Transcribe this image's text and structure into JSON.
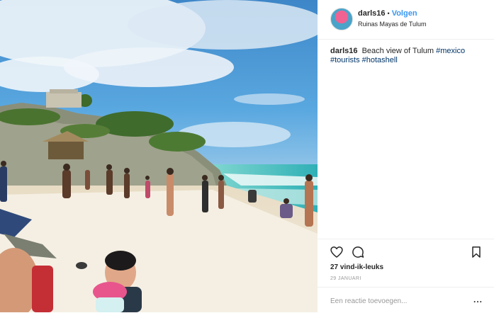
{
  "post": {
    "username": "darls16",
    "separator": "•",
    "follow_label": "Volgen",
    "location": "Ruinas Mayas de Tulum",
    "caption_text": "Beach view of Tulum",
    "hashtags": [
      "#mexico",
      "#tourists",
      "#hotashell"
    ],
    "likes": "27 vind-ik-leuks",
    "date": "29 JANUARI",
    "comment_placeholder": "Een reactie toevoegen...",
    "more_label": "..."
  },
  "icons": {
    "like": "heart-icon",
    "comment": "comment-bubble-icon",
    "save": "bookmark-icon"
  },
  "colors": {
    "follow": "#3897f0",
    "hashtag": "#003569",
    "muted": "#999999"
  }
}
